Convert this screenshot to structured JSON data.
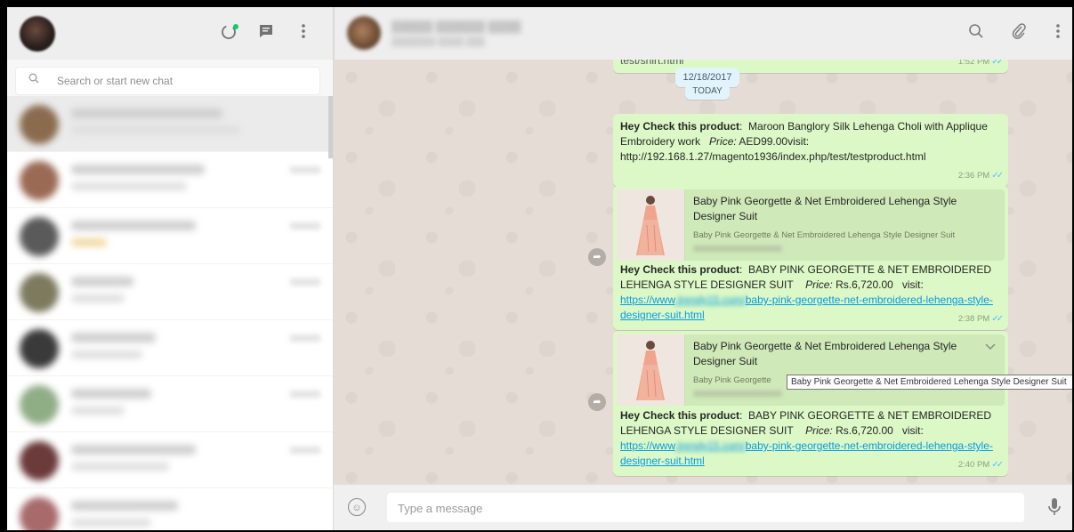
{
  "sidebar": {
    "search_placeholder": "Search or start new chat",
    "icons": [
      "status-icon",
      "new-chat-icon",
      "menu-icon"
    ]
  },
  "conversation": {
    "icons": [
      "search-icon",
      "attach-icon",
      "menu-icon"
    ],
    "prev_message": {
      "text_fragment": "test/shirt.html",
      "time": "1:52 PM"
    },
    "date_pill": "12/18/2017",
    "today_pill": "TODAY",
    "messages": [
      {
        "bold": "Hey Check this product",
        "name": "Maroon Banglory Silk Lehenga Choli with Applique Embroidery work",
        "price_label": "Price:",
        "price": "AED99.00visit:",
        "url": "http://192.168.1.27/magento1936/index.php/test/testproduct.html",
        "time": "2:36 PM"
      },
      {
        "preview_title": "Baby Pink Georgette & Net Embroidered Lehenga Style Designer Suit",
        "preview_desc": "Baby Pink Georgette & Net Embroidered Lehenga Style Designer Suit",
        "bold": "Hey Check this product",
        "name": "BABY PINK GEORGETTE & NET EMBROIDERED LEHENGA STYLE DESIGNER SUIT",
        "price_label": "Price:",
        "price": "Rs.6,720.00",
        "visit": "visit:",
        "url_start": "https://www",
        "url_blurred": ".trendy15.com/",
        "url_rest": "baby-pink-georgette-net-embroidered-lehenga-style-designer-suit.html",
        "time": "2:38 PM"
      },
      {
        "preview_title": "Baby Pink Georgette & Net Embroidered Lehenga Style Designer Suit",
        "preview_desc": "Baby Pink Georgette",
        "bold": "Hey Check this product",
        "name": "BABY PINK GEORGETTE & NET EMBROIDERED LEHENGA STYLE DESIGNER SUIT",
        "price_label": "Price:",
        "price": "Rs.6,720.00",
        "visit": "visit:",
        "url_start": "https://www",
        "url_blurred": ".trendy15.com/",
        "url_rest": "baby-pink-georgette-net-embroidered-lehenga-style-designer-suit.html",
        "time": "2:40 PM"
      }
    ],
    "tooltip": "Baby Pink Georgette & Net Embroidered Lehenga Style Designer Suit",
    "input_placeholder": "Type a message"
  },
  "colors": {
    "outgoing_bubble": "#dcf8c6",
    "chat_background": "#e5ddd5",
    "header_background": "#eeeeee",
    "read_ticks": "#4fc3f7",
    "link": "#039be5"
  }
}
